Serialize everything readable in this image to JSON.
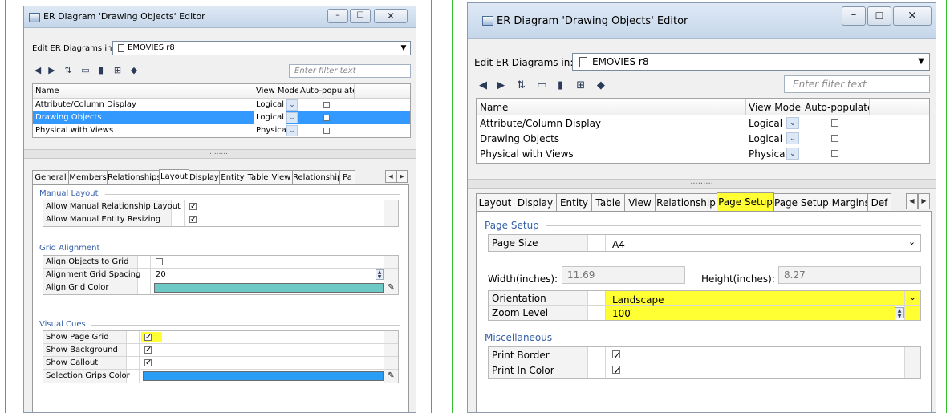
{
  "left_editor": {
    "window": {
      "title": "ER Diagram 'Drawing Objects' Editor"
    },
    "header": {
      "edit_label": "Edit ER Diagrams in:",
      "model_name": "EMOVIES r8"
    },
    "toolbar": {
      "filter_placeholder": "Enter filter text"
    },
    "diagram_table": {
      "columns": [
        "Name",
        "View Mode",
        "Auto-populate"
      ],
      "rows": [
        {
          "name": "Attribute/Column Display",
          "view_mode": "Logical"
        },
        {
          "name": "Drawing Objects",
          "view_mode": "Logical"
        },
        {
          "name": "Physical with Views",
          "view_mode": "Physical"
        }
      ],
      "selected_row": "Drawing Objects"
    },
    "splitter": {
      "grip": "........."
    },
    "tabs": {
      "items": [
        "General",
        "Members",
        "Relationships",
        "Layout",
        "Display",
        "Entity",
        "Table",
        "View",
        "Relationship",
        "Pa"
      ],
      "active": "Layout"
    },
    "manual_layout": {
      "title": "Manual Layout",
      "props": [
        "Allow Manual Relationship Layout",
        "Allow Manual Entity Resizing"
      ]
    },
    "grid_alignment": {
      "title": "Grid Alignment",
      "props": [
        "Align Objects to Grid",
        "Alignment Grid Spacing",
        "Align Grid Color"
      ],
      "spacing_value": "20",
      "grid_color": "#6cc9c5"
    },
    "visual_cues": {
      "title": "Visual Cues",
      "props": [
        "Show Page Grid",
        "Show Background",
        "Show Callout",
        "Selection Grips Color"
      ],
      "grips_color": "#2a9df4"
    }
  },
  "right_editor": {
    "window": {
      "title": "ER Diagram 'Drawing Objects' Editor"
    },
    "header": {
      "edit_label": "Edit ER Diagrams in:",
      "model_name": "EMOVIES r8"
    },
    "toolbar": {
      "filter_placeholder": "Enter filter text"
    },
    "diagram_table": {
      "columns": [
        "Name",
        "View Mode",
        "Auto-populate"
      ],
      "rows": [
        {
          "name": "Attribute/Column Display",
          "view_mode": "Logical"
        },
        {
          "name": "Drawing Objects",
          "view_mode": "Logical"
        },
        {
          "name": "Physical with Views",
          "view_mode": "Physical"
        }
      ]
    },
    "splitter": {
      "grip": "........."
    },
    "tabs": {
      "items": [
        "Layout",
        "Display",
        "Entity",
        "Table",
        "View",
        "Relationship",
        "Page Setup",
        "Page Setup Margins",
        "Def"
      ],
      "active": "Page Setup"
    },
    "page_setup": {
      "title": "Page Setup",
      "page_size_label": "Page Size",
      "page_size_value": "A4",
      "width_label": "Width(inches):",
      "width_value": "11.69",
      "height_label": "Height(inches):",
      "height_value": "8.27",
      "orientation_label": "Orientation",
      "orientation_value": "Landscape",
      "zoom_label": "Zoom Level",
      "zoom_value": "100"
    },
    "misc": {
      "title": "Miscellaneous",
      "props": [
        "Print Border",
        "Print In Color"
      ]
    }
  },
  "colors": {
    "frame": "#2fbf2f",
    "highlight": "#ffff33",
    "selection": "#3399ff",
    "section_title": "#3560a8"
  }
}
